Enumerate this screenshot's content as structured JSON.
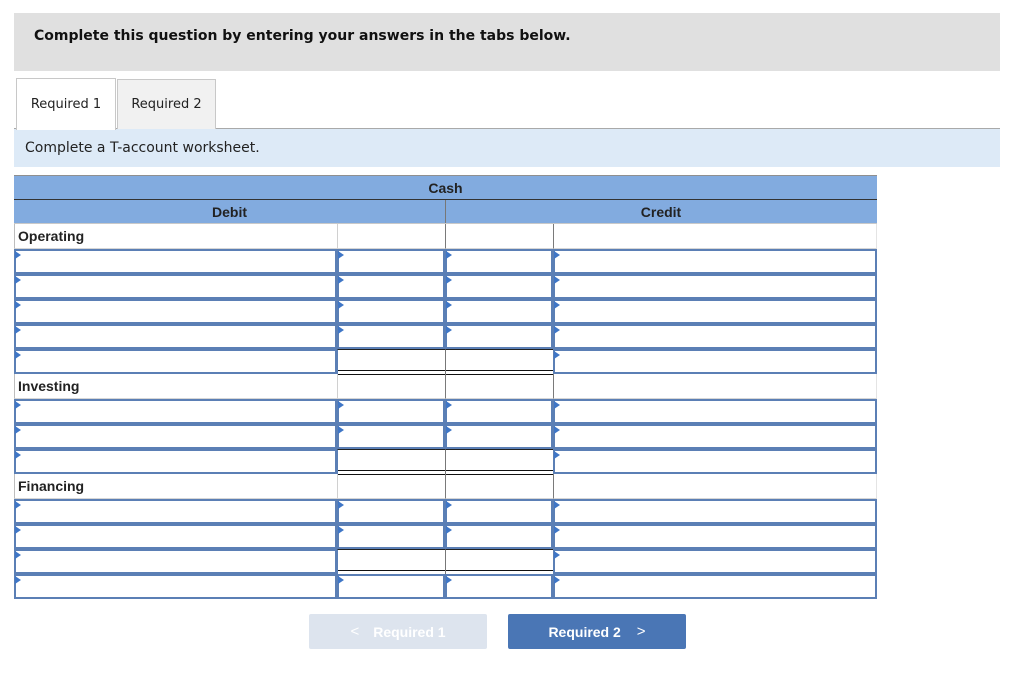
{
  "instruction": "Complete this question by entering your answers in the tabs below.",
  "tabs": [
    {
      "label": "Required 1",
      "active": true
    },
    {
      "label": "Required 2",
      "active": false
    }
  ],
  "sub_instruction": "Complete a T-account worksheet.",
  "worksheet": {
    "account": "Cash",
    "debit_header": "Debit",
    "credit_header": "Credit",
    "sections": [
      {
        "label": "Operating",
        "row_types": [
          "entry",
          "entry",
          "entry",
          "entry",
          "total"
        ]
      },
      {
        "label": "Investing",
        "row_types": [
          "entry",
          "entry",
          "total"
        ]
      },
      {
        "label": "Financing",
        "row_types": [
          "entry",
          "entry",
          "total",
          "entry"
        ]
      }
    ],
    "input_marker_color": "#3f76c6",
    "header_color": "#82abdf"
  },
  "navigation": {
    "prev_label": "Required 1",
    "prev_icon": "chevron-left-icon",
    "prev_enabled": false,
    "next_label": "Required 2",
    "next_icon": "chevron-right-icon",
    "next_enabled": true
  }
}
